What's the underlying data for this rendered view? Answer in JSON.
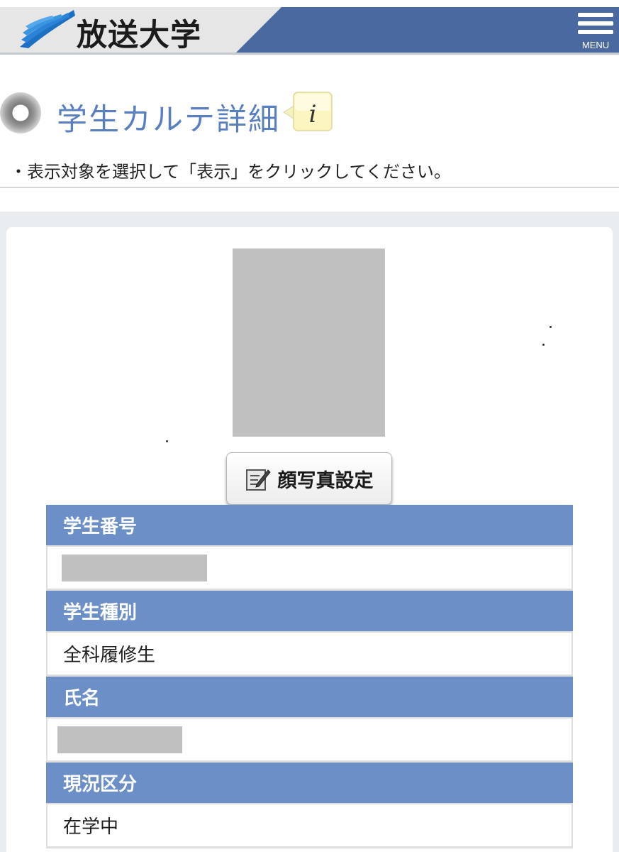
{
  "header": {
    "brand": "放送大学",
    "menu_label": "MENU",
    "colors": {
      "bar": "#4969a0",
      "gray": "#e6e6e6"
    }
  },
  "page": {
    "title": "学生カルテ詳細",
    "info_icon_glyph": "i",
    "instruction": "・表示対象を選択して「表示」をクリックしてください。"
  },
  "photo": {
    "button_label": "顔写真設定",
    "button_icon": "edit-note-icon"
  },
  "student": {
    "rows": [
      {
        "label": "学生番号",
        "value": "",
        "redacted": true
      },
      {
        "label": "学生種別",
        "value": "全科履修生",
        "redacted": false
      },
      {
        "label": "氏名",
        "value": "",
        "redacted": true
      },
      {
        "label": "現況区分",
        "value": "在学中",
        "redacted": false
      }
    ]
  },
  "colors": {
    "accent": "#6c8fc8",
    "title": "#5a7fbf"
  }
}
